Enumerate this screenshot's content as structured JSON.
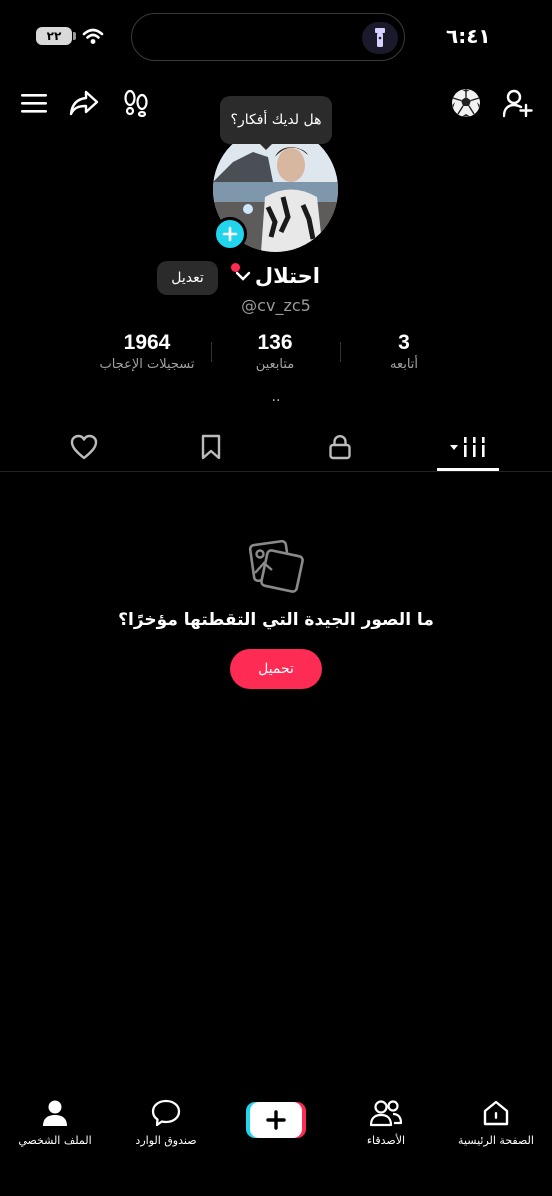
{
  "status_bar": {
    "battery": "٢٢",
    "time": "٦:٤١"
  },
  "tooltip": {
    "text": "هل لديك أفكار؟"
  },
  "profile": {
    "username": "احتلال",
    "handle": "@cv_zc5",
    "edit_label": "تعديل",
    "bio": ".."
  },
  "stats": [
    {
      "value": "3",
      "label": "أتابعه"
    },
    {
      "value": "136",
      "label": "متابعين"
    },
    {
      "value": "1964",
      "label": "تسجيلات الإعجاب"
    }
  ],
  "empty_state": {
    "text": "ما الصور الجيدة التي التقطتها مؤخرًا؟",
    "button": "تحميل"
  },
  "bottom_nav": [
    {
      "label": "الصفحة الرئيسية",
      "icon": "home-icon"
    },
    {
      "label": "الأصدقاء",
      "icon": "friends-icon"
    },
    {
      "label": "",
      "icon": "create-icon"
    },
    {
      "label": "صندوق الوارد",
      "icon": "inbox-icon"
    },
    {
      "label": "الملف الشخصي",
      "icon": "profile-icon"
    }
  ],
  "colors": {
    "accent": "#fe2c55",
    "cyan": "#20d5ec",
    "background": "#000000"
  }
}
